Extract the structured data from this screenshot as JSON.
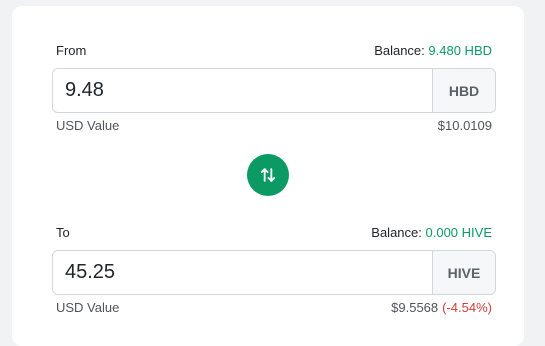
{
  "from": {
    "label": "From",
    "balance_label": "Balance:",
    "balance_value": "9.480 HBD",
    "amount": "9.48",
    "currency": "HBD",
    "usd_label": "USD Value",
    "usd_value": "$10.0109"
  },
  "swap": {
    "icon": "swap-vertical-icon",
    "color": "#0b9a63"
  },
  "to": {
    "label": "To",
    "balance_label": "Balance:",
    "balance_value": "0.000 HIVE",
    "amount": "45.25",
    "currency": "HIVE",
    "usd_label": "USD Value",
    "usd_value": "$9.5568",
    "usd_delta": "(-4.54%)"
  },
  "colors": {
    "accent": "#0b9a63",
    "negative": "#d43b3b"
  }
}
